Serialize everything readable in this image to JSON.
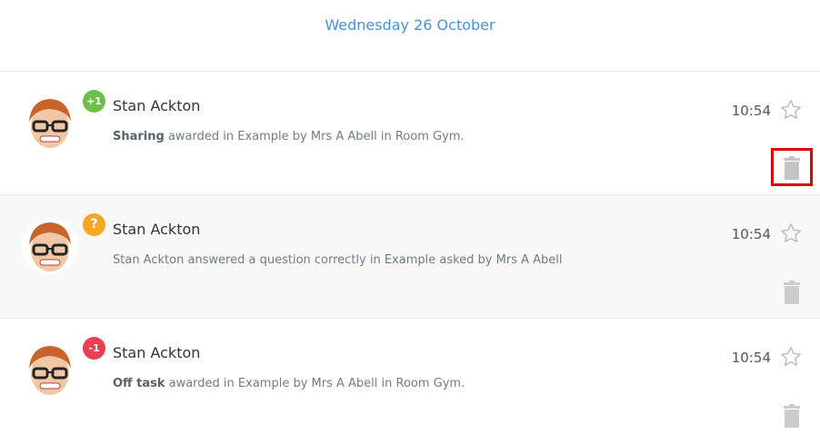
{
  "header": {
    "date": "Wednesday 26 October"
  },
  "icons": {
    "star": "star-outline-icon",
    "trash": "trash-icon"
  },
  "colors": {
    "date_text": "#4a90d9",
    "badge_positive": "#6cc04a",
    "badge_question": "#f5a623",
    "badge_negative": "#e84050",
    "highlight_border": "#e00000"
  },
  "feed": {
    "items": [
      {
        "badge": "+1",
        "badge_type": "positive",
        "name": "Stan Ackton",
        "desc_bold": "Sharing",
        "desc_rest": " awarded in Example by Mrs A Abell in Room Gym.",
        "time": "10:54"
      },
      {
        "badge": "?",
        "badge_type": "question",
        "name": "Stan Ackton",
        "desc_bold": "",
        "desc_rest": "Stan Ackton answered a question correctly in Example asked by Mrs A Abell",
        "time": "10:54"
      },
      {
        "badge": "-1",
        "badge_type": "negative",
        "name": "Stan Ackton",
        "desc_bold": "Off task",
        "desc_rest": " awarded in Example by Mrs A Abell in Room Gym.",
        "time": "10:54"
      }
    ]
  }
}
